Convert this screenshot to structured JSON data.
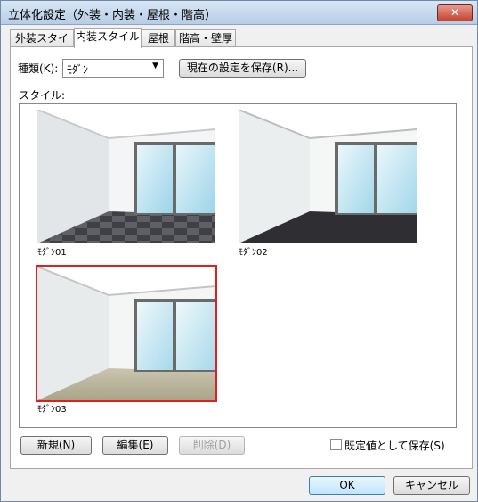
{
  "window": {
    "title": "立体化設定（外装・内装・屋根・階高）",
    "close_label": "✕"
  },
  "tabs": [
    "外装スタイル",
    "内装スタイル",
    "屋根",
    "階高・壁厚"
  ],
  "type_label": "種類(K):",
  "type_value": "ﾓﾀﾞﾝ",
  "save_current_label": "現在の設定を保存(R)...",
  "style_label": "スタイル:",
  "styles": [
    {
      "caption": "ﾓﾀﾞﾝ01",
      "floor": "tile"
    },
    {
      "caption": "ﾓﾀﾞﾝ02",
      "floor": "dark"
    },
    {
      "caption": "ﾓﾀﾞﾝ03",
      "floor": "stone",
      "selected": true
    }
  ],
  "buttons": {
    "new": "新規(N)",
    "edit": "編集(E)",
    "delete": "削除(D)",
    "ok": "OK",
    "cancel": "キャンセル"
  },
  "save_default_label": "既定値として保存(S)",
  "colors": {
    "selection": "#e02020",
    "title_bar": "#c8dbef",
    "close_button": "#c64430"
  }
}
